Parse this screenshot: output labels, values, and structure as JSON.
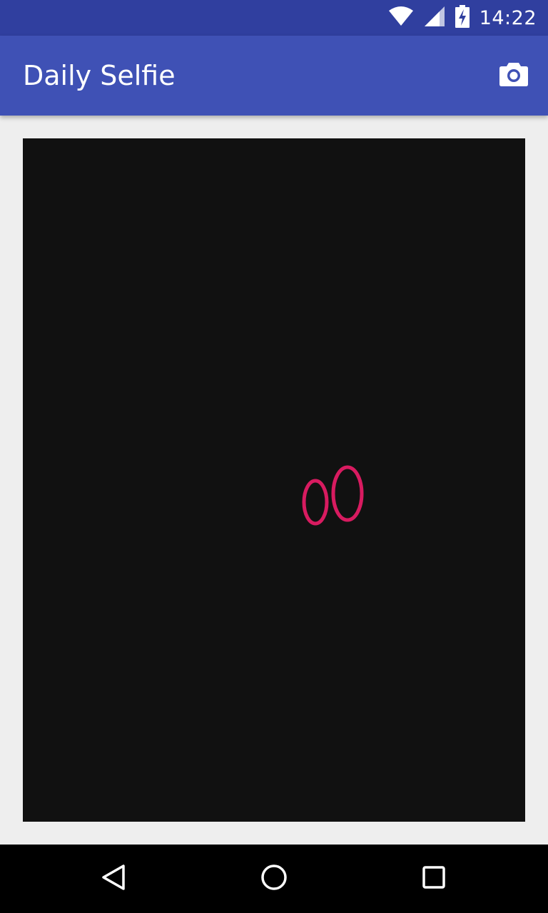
{
  "status_bar": {
    "time": "14:22",
    "icons": [
      "wifi-icon",
      "signal-icon",
      "battery-charging-icon"
    ],
    "background": "#303f9f"
  },
  "app_bar": {
    "title": "Daily Selfie",
    "action_icon": "camera-icon",
    "background": "#3f51b5"
  },
  "content": {
    "background": "#eeeeee",
    "selfie_thumbnail": {
      "background": "#111111",
      "accent": "#d81b60"
    }
  },
  "nav_bar": {
    "icons": [
      "back-icon",
      "home-icon",
      "recents-icon"
    ]
  }
}
